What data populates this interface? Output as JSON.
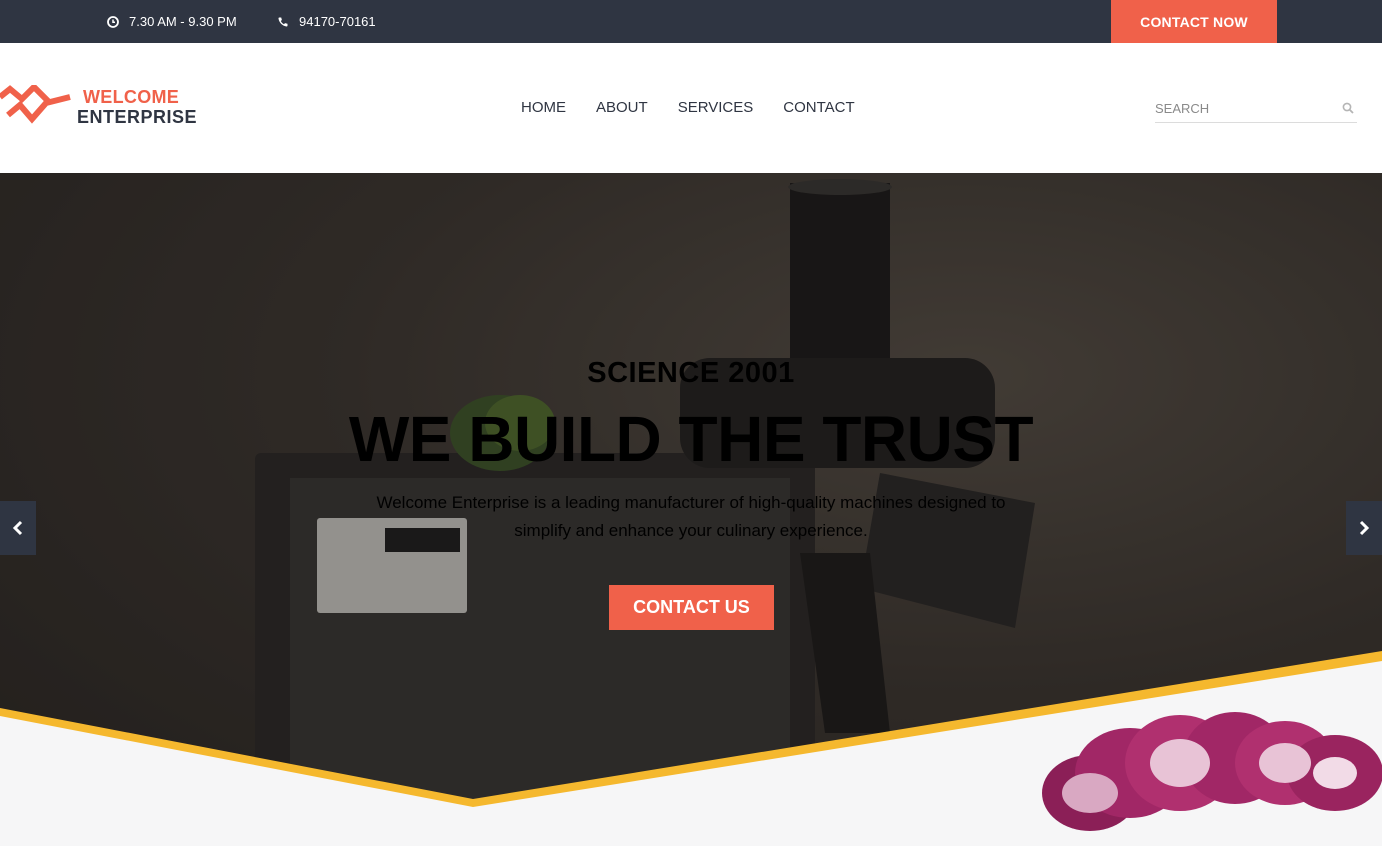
{
  "topbar": {
    "hours": "7.30 AM - 9.30 PM",
    "hours_icon": "clock-icon",
    "phone": "94170-70161",
    "phone_icon": "phone-icon",
    "contact_now": "CONTACT NOW"
  },
  "brand": {
    "line1": "WELCOME",
    "line2": "ENTERPRISE",
    "logo_icon": "double-chevron-logo"
  },
  "nav": {
    "items": [
      "HOME",
      "ABOUT",
      "SERVICES",
      "CONTACT"
    ]
  },
  "search": {
    "placeholder": "SEARCH",
    "icon": "search-icon"
  },
  "hero": {
    "kicker": "SCIENCE 2001",
    "headline": "WE BUILD THE TRUST",
    "description": "Welcome Enterprise is a leading manufacturer of high-quality machines designed to simplify and enhance your culinary experience.",
    "cta": "CONTACT US",
    "prev_icon": "chevron-left-icon",
    "next_icon": "chevron-right-icon"
  },
  "colors": {
    "accent": "#f0614a",
    "dark": "#2f3542",
    "divider": "#f5b82e"
  }
}
